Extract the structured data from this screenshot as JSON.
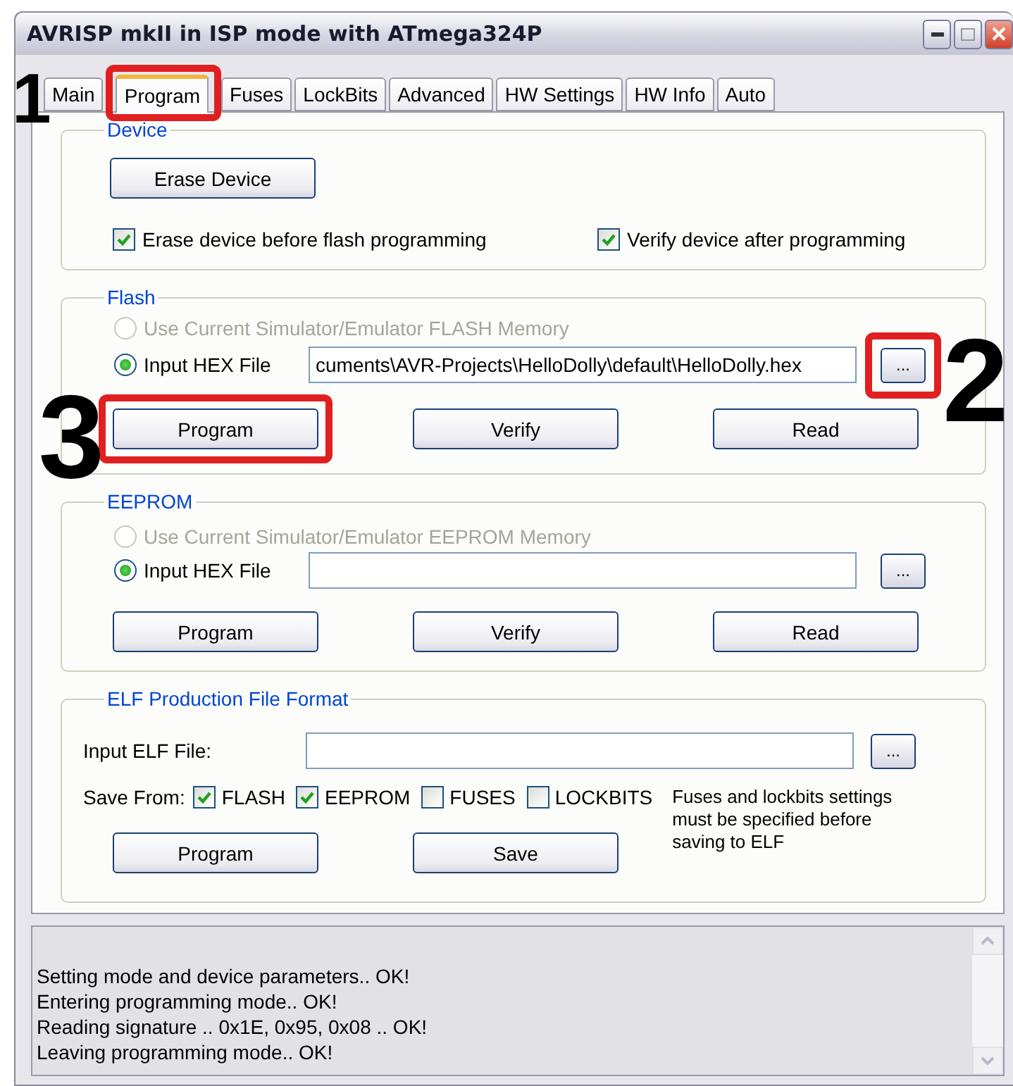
{
  "window": {
    "title": "AVRISP mkII in ISP mode with ATmega324P"
  },
  "tabs": [
    {
      "label": "Main",
      "selected": false
    },
    {
      "label": "Program",
      "selected": true
    },
    {
      "label": "Fuses",
      "selected": false
    },
    {
      "label": "LockBits",
      "selected": false
    },
    {
      "label": "Advanced",
      "selected": false
    },
    {
      "label": "HW Settings",
      "selected": false
    },
    {
      "label": "HW Info",
      "selected": false
    },
    {
      "label": "Auto",
      "selected": false
    }
  ],
  "device": {
    "legend": "Device",
    "button": "Erase Device",
    "options": [
      {
        "label": "Erase device before flash programming",
        "checked": true
      },
      {
        "label": "Verify device after programming",
        "checked": true
      }
    ]
  },
  "flash": {
    "legend": "Flash",
    "sources": [
      {
        "label": "Use Current Simulator/Emulator FLASH Memory",
        "selected": false,
        "disabled": true
      },
      {
        "label": "Input HEX File",
        "selected": true,
        "disabled": false
      }
    ],
    "file_value": "cuments\\AVR-Projects\\HelloDolly\\default\\HelloDolly.hex",
    "browse": "...",
    "buttons": [
      "Program",
      "Verify",
      "Read"
    ]
  },
  "eeprom": {
    "legend": "EEPROM",
    "sources": [
      {
        "label": "Use Current Simulator/Emulator EEPROM Memory",
        "selected": false,
        "disabled": true
      },
      {
        "label": "Input HEX File",
        "selected": true,
        "disabled": false
      }
    ],
    "browse": "...",
    "buttons": [
      "Program",
      "Verify",
      "Read"
    ]
  },
  "elf": {
    "legend": "ELF Production File Format",
    "file_label": "Input ELF File:",
    "browse": "...",
    "save_from_label": "Save From:",
    "save_from": [
      {
        "label": "FLASH",
        "checked": true
      },
      {
        "label": "EEPROM",
        "checked": true
      },
      {
        "label": "FUSES",
        "checked": false
      },
      {
        "label": "LOCKBITS",
        "checked": false
      }
    ],
    "note": "Fuses and lockbits settings must be specified before saving to ELF",
    "buttons": [
      "Program",
      "Save"
    ]
  },
  "log": [
    "Setting mode and device parameters.. OK!",
    "Entering programming mode.. OK!",
    "Reading signature .. 0x1E, 0x95, 0x08 .. OK!",
    "Leaving programming mode.. OK!"
  ],
  "annotations": [
    {
      "label": "1",
      "kind": "tab"
    },
    {
      "label": "2",
      "kind": "browse"
    },
    {
      "label": "3",
      "kind": "program"
    }
  ]
}
